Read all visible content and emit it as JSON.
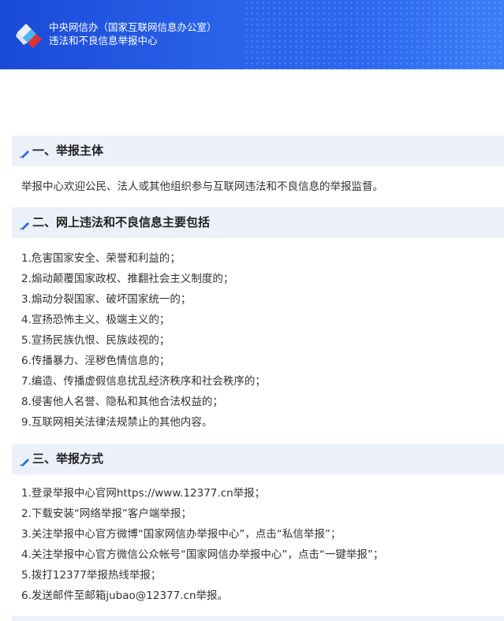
{
  "banner": {
    "line1": "中央网信办（国家互联网信息办公室）",
    "line2": "违法和不良信息举报中心"
  },
  "sections": [
    {
      "title": "一、举报主体",
      "text": "举报中心欢迎公民、法人或其他组织参与互联网违法和不良信息的举报监督。"
    },
    {
      "title": "二、网上违法和不良信息主要包括",
      "items": [
        "1.危害国家安全、荣誉和利益的；",
        "2.煽动颠覆国家政权、推翻社会主义制度的；",
        "3.煽动分裂国家、破坏国家统一的；",
        "4.宣扬恐怖主义、极端主义的；",
        "5.宣扬民族仇恨、民族歧视的；",
        "6.传播暴力、淫秽色情信息的；",
        "7.编造、传播虚假信息扰乱经济秩序和社会秩序的；",
        "8.侵害他人名誉、隐私和其他合法权益的；",
        "9.互联网相关法律法规禁止的其他内容。"
      ]
    },
    {
      "title": "三、举报方式",
      "items": [
        "1.登录举报中心官网https://www.12377.cn举报；",
        "2.下载安装“网络举报”客户端举报；",
        "3.关注举报中心官方微博“国家网信办举报中心”，点击“私信举报”；",
        "4.关注举报中心官方微信公众帐号“国家网信办举报中心”，点击“一键举报”；",
        "5.拨打12377举报热线举报；",
        "6.发送邮件至邮箱jubao@12377.cn举报。"
      ]
    }
  ],
  "colors": {
    "banner_blue": "#2a63ea",
    "section_bg": "#ecf1f9",
    "accent_blue": "#2f6fd6",
    "logo_red": "#e03232"
  },
  "icons": {
    "logo": "reporting-center-logo",
    "section_marker": "pen-icon"
  }
}
